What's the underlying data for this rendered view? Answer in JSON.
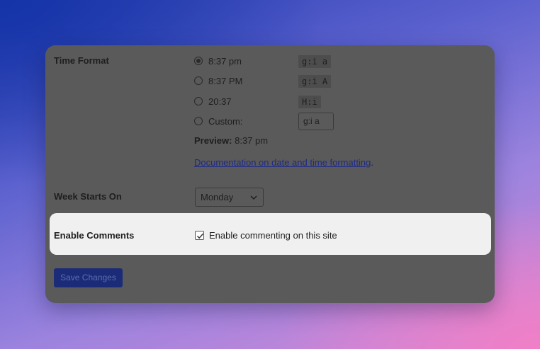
{
  "settings": {
    "time_format": {
      "label": "Time Format",
      "options": [
        {
          "label": "8:37 pm",
          "code": "g:i a",
          "checked": true
        },
        {
          "label": "8:37 PM",
          "code": "g:i A",
          "checked": false
        },
        {
          "label": "20:37",
          "code": "H:i",
          "checked": false
        },
        {
          "label": "Custom:",
          "code": "",
          "checked": false
        }
      ],
      "custom_value": "g:i a",
      "preview_label": "Preview:",
      "preview_value": "8:37 pm",
      "doc_link": "Documentation on date and time formatting",
      "doc_suffix": "."
    },
    "week_starts_on": {
      "label": "Week Starts On",
      "selected": "Monday"
    },
    "enable_comments": {
      "label": "Enable Comments",
      "checkbox_label": "Enable commenting on this site",
      "checked": true
    },
    "save_label": "Save Changes"
  },
  "colors": {
    "panel_overlay": "#5a5a5a",
    "highlight": "#f0f0f0",
    "button": "#1c2b78",
    "link": "#1d2a8a"
  }
}
